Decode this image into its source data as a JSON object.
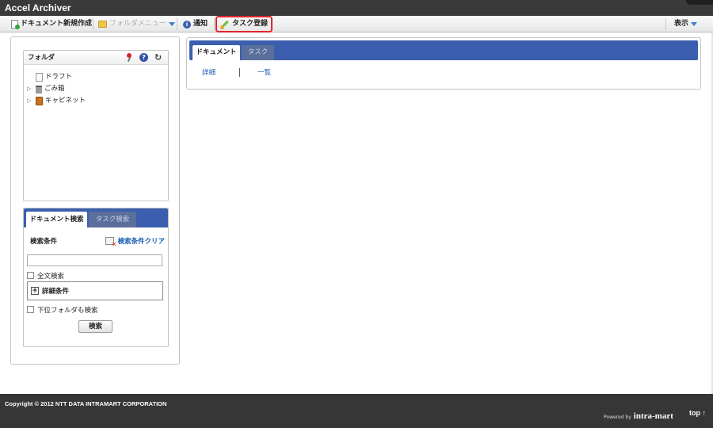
{
  "app": {
    "title": "Accel Archiver"
  },
  "toolbar": {
    "new_document": "ドキュメント新規作成",
    "folder_menu": "フォルダメニュー",
    "notification": "通知",
    "task_register": "タスク登録",
    "display": "表示"
  },
  "folder_panel": {
    "title": "フォルダ",
    "tree": [
      {
        "label": "ドラフト",
        "expandable": false,
        "icon": "draft-icon"
      },
      {
        "label": "ごみ箱",
        "expandable": true,
        "icon": "trash-icon"
      },
      {
        "label": "キャビネット",
        "expandable": true,
        "icon": "cabinet-icon"
      }
    ]
  },
  "search_panel": {
    "tabs": [
      "ドキュメント検索",
      "タスク検索"
    ],
    "active_tab": 0,
    "condition_label": "検索条件",
    "clear_label": "検索条件クリア",
    "search_value": "",
    "full_text_label": "全文検索",
    "detail_label": "詳細条件",
    "subfolder_label": "下位フォルダも検索",
    "search_button": "検索"
  },
  "main_panel": {
    "tabs": [
      "ドキュメント",
      "タスク"
    ],
    "active_tab": 0,
    "links": [
      "詳細",
      "一覧"
    ]
  },
  "footer": {
    "copyright": "Copyright © 2012 NTT DATA INTRAMART CORPORATION",
    "powered_by": "Powered by",
    "brand": "intra-mart",
    "top_link": "top ↑"
  },
  "colors": {
    "tab_bar": "#3b5fae",
    "link": "#1a5fb4",
    "highlight": "#e0252b"
  }
}
